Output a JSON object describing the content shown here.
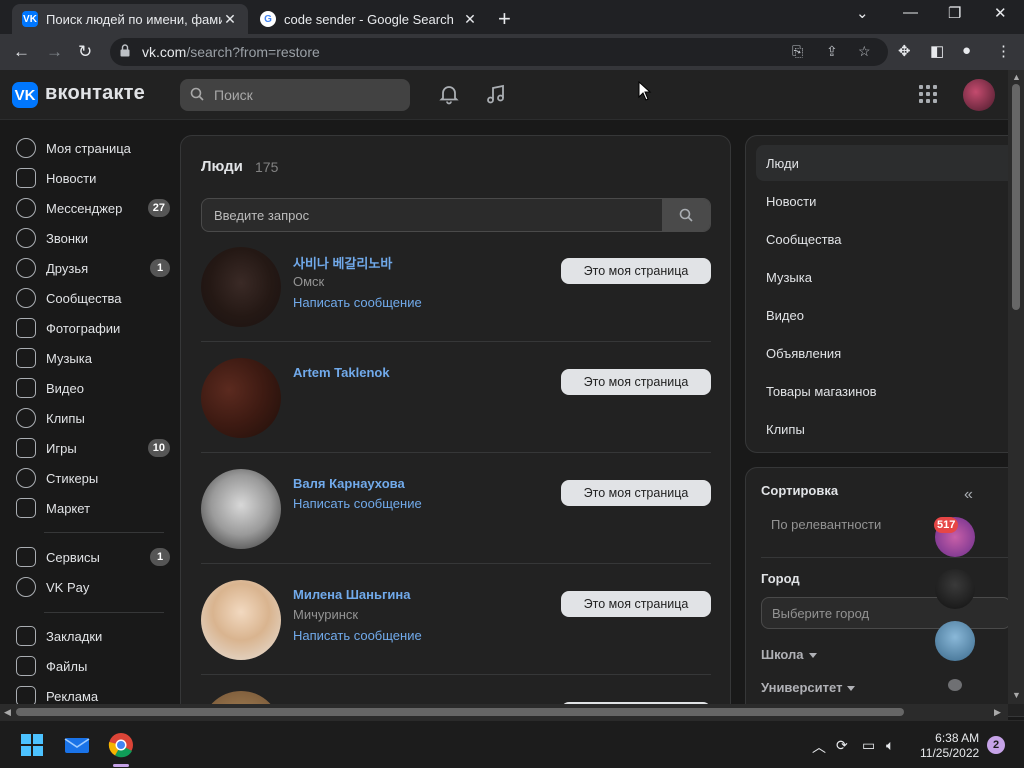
{
  "browser": {
    "tabs": [
      {
        "title": "Поиск людей по имени, фамилии",
        "active": true
      },
      {
        "title": "code sender - Google Search",
        "active": false
      }
    ],
    "url_host": "vk.com",
    "url_path": "/search?from=restore"
  },
  "vk": {
    "logo_text": "вконтакте",
    "search_placeholder": "Поиск"
  },
  "leftnav": {
    "items": [
      {
        "label": "Моя страница",
        "icon": "user-icon"
      },
      {
        "label": "Новости",
        "icon": "news-icon"
      },
      {
        "label": "Мессенджер",
        "icon": "messenger-icon",
        "badge": "27"
      },
      {
        "label": "Звонки",
        "icon": "phone-icon"
      },
      {
        "label": "Друзья",
        "icon": "friends-icon",
        "badge": "1"
      },
      {
        "label": "Сообщества",
        "icon": "communities-icon"
      },
      {
        "label": "Фотографии",
        "icon": "photos-icon"
      },
      {
        "label": "Музыка",
        "icon": "music-icon"
      },
      {
        "label": "Видео",
        "icon": "video-icon"
      },
      {
        "label": "Клипы",
        "icon": "clips-icon"
      },
      {
        "label": "Игры",
        "icon": "games-icon",
        "badge": "10"
      },
      {
        "label": "Стикеры",
        "icon": "stickers-icon"
      },
      {
        "label": "Маркет",
        "icon": "market-icon"
      },
      {
        "label": "Сервисы",
        "icon": "services-icon",
        "badge": "1"
      },
      {
        "label": "VK Pay",
        "icon": "vkpay-icon"
      },
      {
        "label": "Закладки",
        "icon": "bookmarks-icon"
      },
      {
        "label": "Файлы",
        "icon": "files-icon"
      },
      {
        "label": "Реклама",
        "icon": "ads-icon"
      }
    ]
  },
  "results": {
    "title": "Люди",
    "count": "175",
    "query_placeholder": "Введите запрос",
    "people": [
      {
        "name": "사비나 베갈리노바",
        "city": "Омск",
        "message": "Написать сообщение",
        "action": "Это моя страница"
      },
      {
        "name": "Artem Taklenok",
        "city": "",
        "message": "",
        "action": "Это моя страница"
      },
      {
        "name": "Валя Карнаухова",
        "city": "",
        "message": "Написать сообщение",
        "action": "Это моя страница"
      },
      {
        "name": "Милена Шаньгина",
        "city": "Мичуринск",
        "message": "Написать сообщение",
        "action": "Это моя страница"
      }
    ]
  },
  "rightnav": {
    "items": [
      "Люди",
      "Новости",
      "Сообщества",
      "Музыка",
      "Видео",
      "Объявления",
      "Товары магазинов",
      "Клипы"
    ]
  },
  "filters": {
    "sort_title": "Сортировка",
    "sort_value": "По релевантности",
    "city_title": "Город",
    "city_placeholder": "Выберите город",
    "school_label": "Школа",
    "university_label": "Университет",
    "unread_badge": "517"
  },
  "taskbar": {
    "time": "6:38 AM",
    "date": "11/25/2022",
    "notifications": "2"
  }
}
